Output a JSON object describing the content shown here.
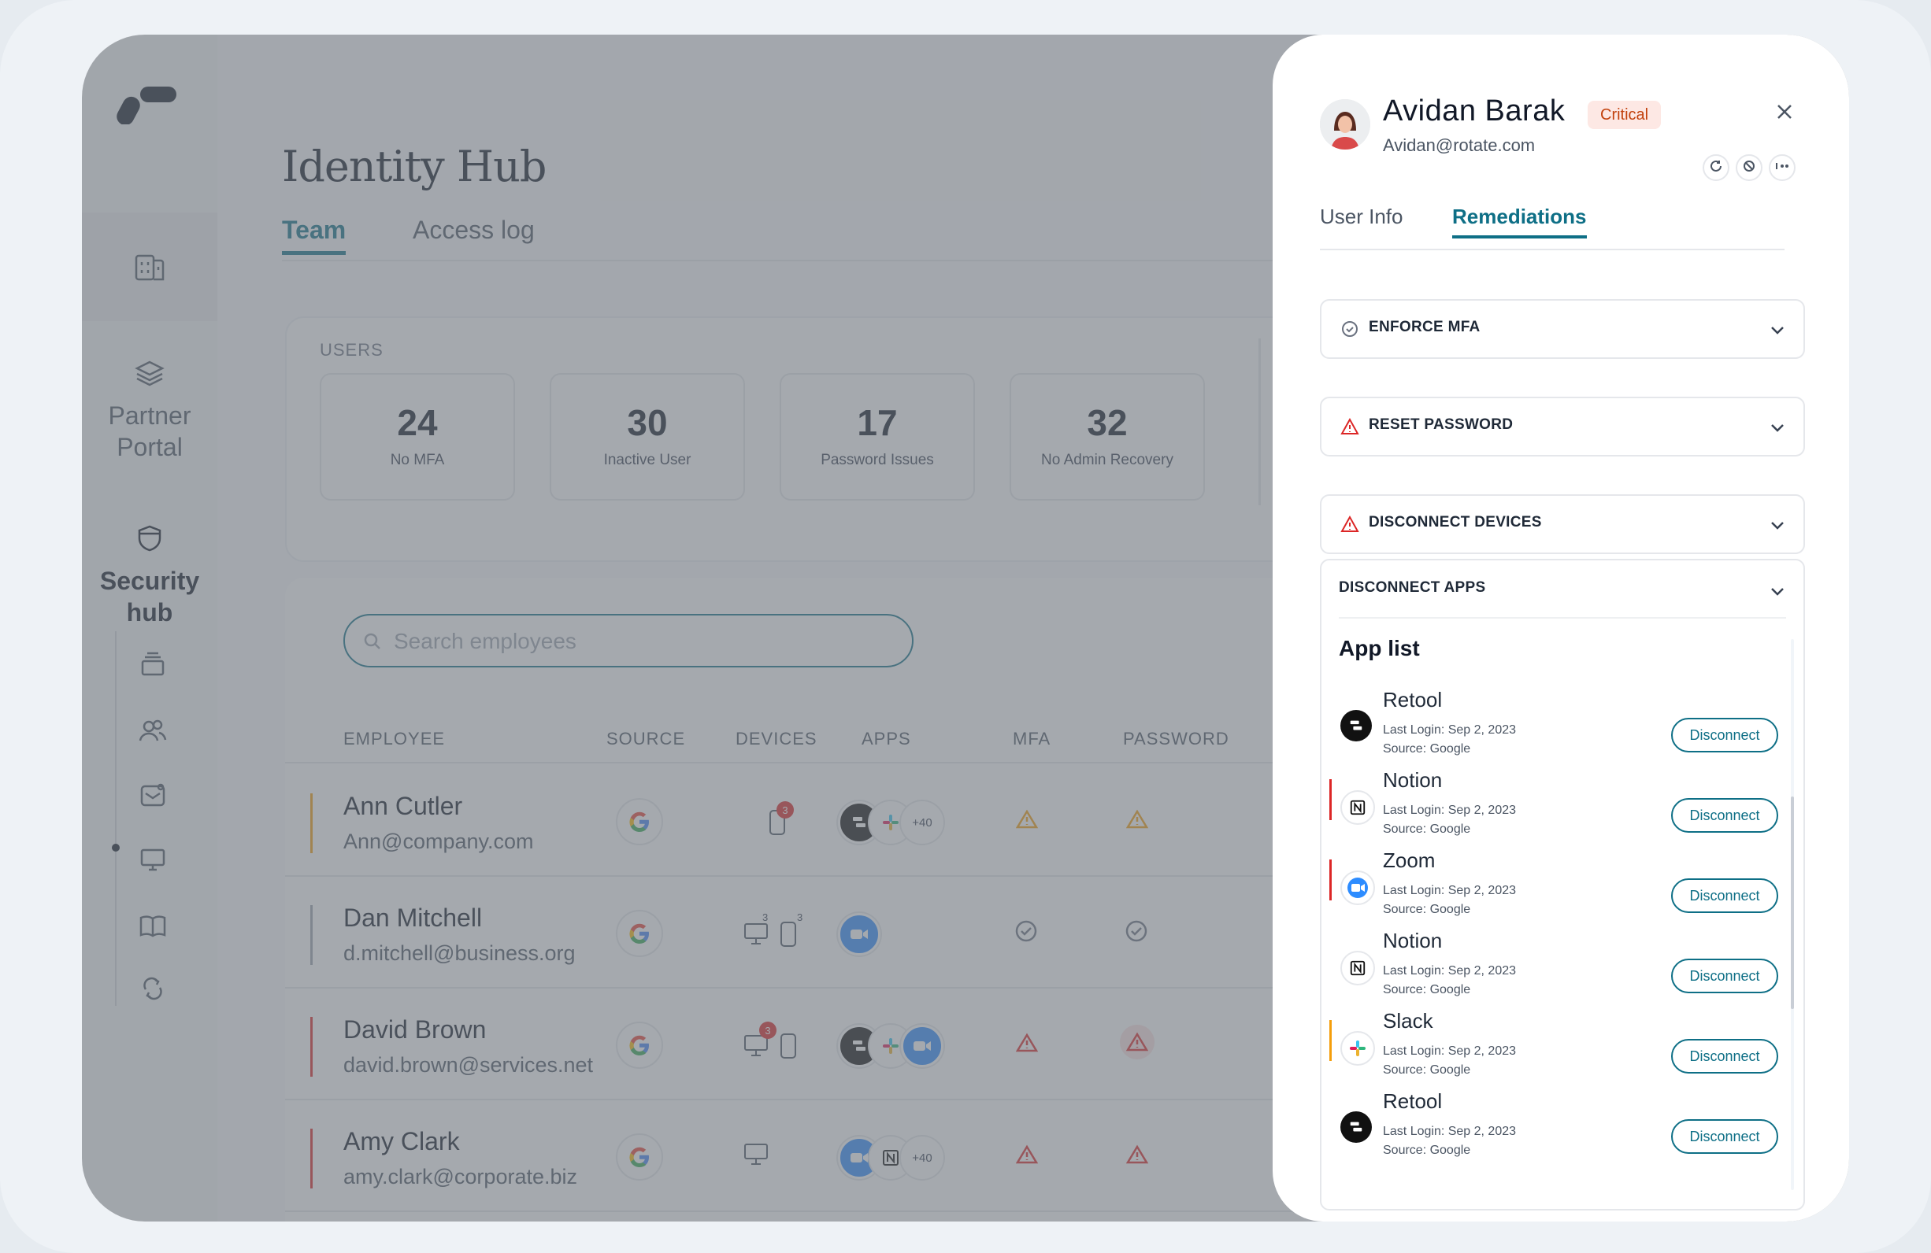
{
  "sidebar": {
    "partner_portal_label": "Partner Portal",
    "security_hub_label": "Security hub"
  },
  "main": {
    "title": "Identity Hub",
    "tabs": [
      {
        "label": "Team",
        "active": true
      },
      {
        "label": "Access log",
        "active": false
      }
    ],
    "users_label": "USERS",
    "stats": [
      {
        "value": "24",
        "label": "No MFA"
      },
      {
        "value": "30",
        "label": "Inactive User"
      },
      {
        "value": "17",
        "label": "Password Issues"
      },
      {
        "value": "32",
        "label": "No Admin Recovery"
      }
    ],
    "search_placeholder": "Search employees",
    "columns": [
      "EMPLOYEE",
      "SOURCE",
      "DEVICES",
      "APPS",
      "MFA",
      "PASSWORD"
    ],
    "rows": [
      {
        "name": "Ann Cutler",
        "email": "Ann@company.com",
        "apps_more": "+40",
        "device_badge": "3",
        "risk_color": "#f59e0b"
      },
      {
        "name": "Dan Mitchell",
        "email": "d.mitchell@business.org",
        "device_count_desktop": "3",
        "device_count_mobile": "3",
        "risk_color": "#9ca3af"
      },
      {
        "name": "David Brown",
        "email": "david.brown@services.net",
        "device_badge": "3",
        "risk_color": "#dc2626"
      },
      {
        "name": "Amy Clark",
        "email": "amy.clark@corporate.biz",
        "apps_more": "+40",
        "risk_color": "#dc2626"
      }
    ]
  },
  "panel": {
    "user_name": "Avidan Barak",
    "severity": "Critical",
    "user_email": "Avidan@rotate.com",
    "tabs": [
      {
        "label": "User Info",
        "active": false
      },
      {
        "label": "Remediations",
        "active": true
      }
    ],
    "remediations": [
      {
        "title": "ENFORCE MFA",
        "icon": "check-circle-icon"
      },
      {
        "title": "RESET PASSWORD",
        "icon": "warning-icon"
      },
      {
        "title": "DISCONNECT DEVICES",
        "icon": "warning-icon"
      }
    ],
    "disconnect_apps": {
      "title": "DISCONNECT APPS",
      "list_title": "App list",
      "button_label": "Disconnect",
      "apps": [
        {
          "name": "Retool",
          "last_login": "Last Login: Sep 2, 2023",
          "source": "Source: Google",
          "icon": "retool-icon",
          "marker": ""
        },
        {
          "name": "Notion",
          "last_login": "Last Login: Sep 2, 2023",
          "source": "Source: Google",
          "icon": "notion-icon",
          "marker": "#dc2626"
        },
        {
          "name": "Zoom",
          "last_login": "Last Login: Sep 2, 2023",
          "source": "Source: Google",
          "icon": "zoom-icon",
          "marker": "#dc2626"
        },
        {
          "name": "Notion",
          "last_login": "Last Login: Sep 2, 2023",
          "source": "Source: Google",
          "icon": "notion-icon",
          "marker": ""
        },
        {
          "name": "Slack",
          "last_login": "Last Login: Sep 2, 2023",
          "source": "Source: Google",
          "icon": "slack-icon",
          "marker": "#f59e0b"
        },
        {
          "name": "Retool",
          "last_login": "Last Login: Sep 2, 2023",
          "source": "Source: Google",
          "icon": "retool-icon",
          "marker": ""
        }
      ]
    }
  },
  "colors": {
    "accent": "#0e6f86",
    "critical_bg": "#fde8e4",
    "critical_text": "#c2410c",
    "warning": "#f59e0b",
    "danger": "#dc2626"
  }
}
